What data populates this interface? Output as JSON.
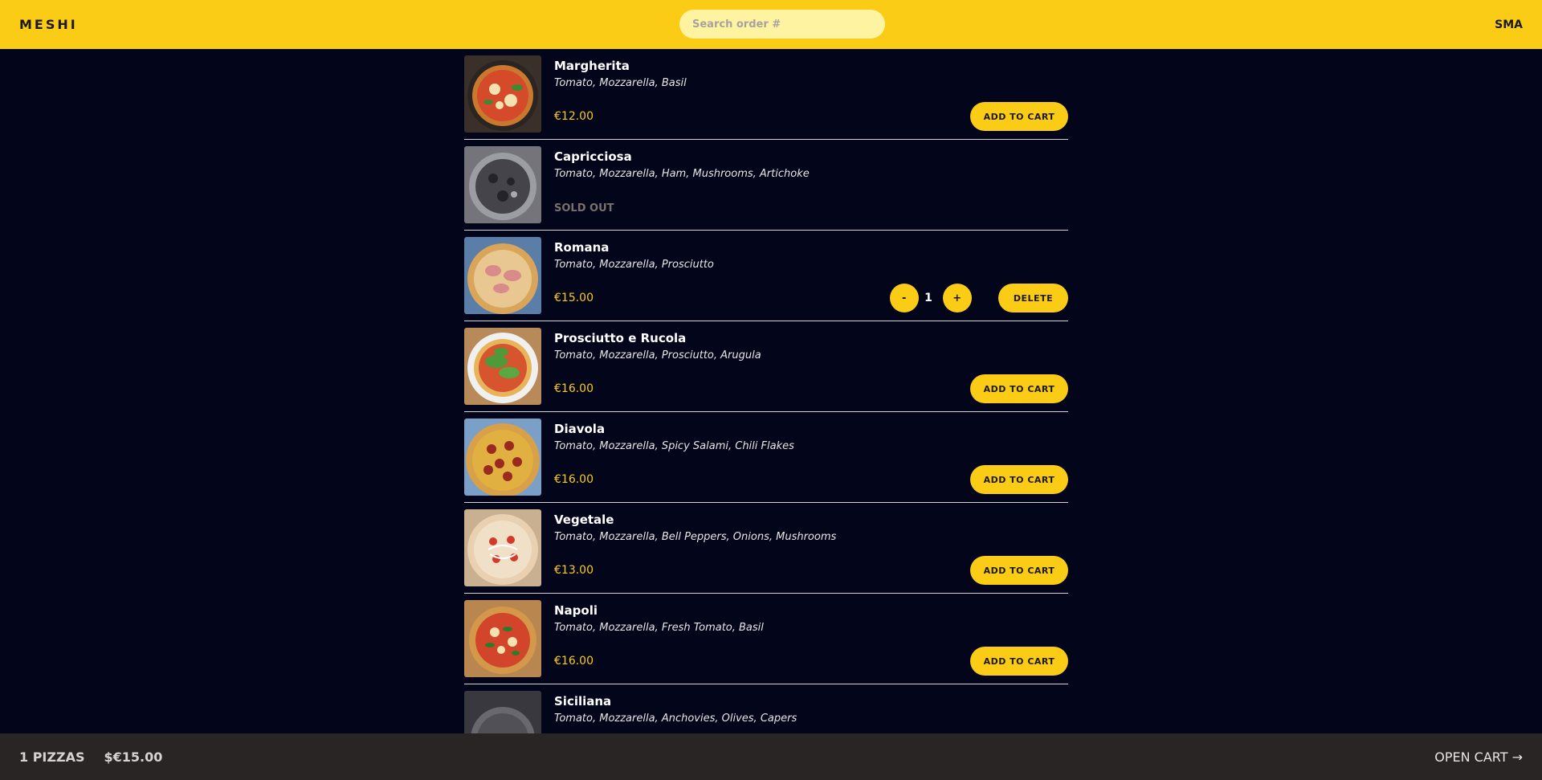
{
  "header": {
    "logo": "MESHI",
    "search_placeholder": "Search order #",
    "user": "SMA"
  },
  "menu": {
    "items": [
      {
        "name": "Margherita",
        "ingredients": "Tomato, Mozzarella, Basil",
        "price": "€12.00",
        "status": "available",
        "action": "ADD TO CART",
        "image": "pizza-margherita"
      },
      {
        "name": "Capricciosa",
        "ingredients": "Tomato, Mozzarella, Ham, Mushrooms, Artichoke",
        "price": "",
        "status": "SOLD OUT",
        "action": "",
        "image": "pizza-capricciosa"
      },
      {
        "name": "Romana",
        "ingredients": "Tomato, Mozzarella, Prosciutto",
        "price": "€15.00",
        "status": "in-cart",
        "quantity": "1",
        "minus": "-",
        "plus": "+",
        "action": "DELETE",
        "image": "pizza-romana"
      },
      {
        "name": "Prosciutto e Rucola",
        "ingredients": "Tomato, Mozzarella, Prosciutto, Arugula",
        "price": "€16.00",
        "status": "available",
        "action": "ADD TO CART",
        "image": "pizza-prosciutto-rucola"
      },
      {
        "name": "Diavola",
        "ingredients": "Tomato, Mozzarella, Spicy Salami, Chili Flakes",
        "price": "€16.00",
        "status": "available",
        "action": "ADD TO CART",
        "image": "pizza-diavola"
      },
      {
        "name": "Vegetale",
        "ingredients": "Tomato, Mozzarella, Bell Peppers, Onions, Mushrooms",
        "price": "€13.00",
        "status": "available",
        "action": "ADD TO CART",
        "image": "pizza-vegetale"
      },
      {
        "name": "Napoli",
        "ingredients": "Tomato, Mozzarella, Fresh Tomato, Basil",
        "price": "€16.00",
        "status": "available",
        "action": "ADD TO CART",
        "image": "pizza-napoli"
      },
      {
        "name": "Siciliana",
        "ingredients": "Tomato, Mozzarella, Anchovies, Olives, Capers",
        "price": "",
        "status": "cut-off",
        "action": "",
        "image": "pizza-siciliana"
      }
    ]
  },
  "footer": {
    "count": "1 PIZZAS",
    "total": "$€15.00",
    "open_cart": "OPEN CART →"
  },
  "colors": {
    "accent": "#facc15",
    "background": "#03051a",
    "footer": "#292524"
  }
}
